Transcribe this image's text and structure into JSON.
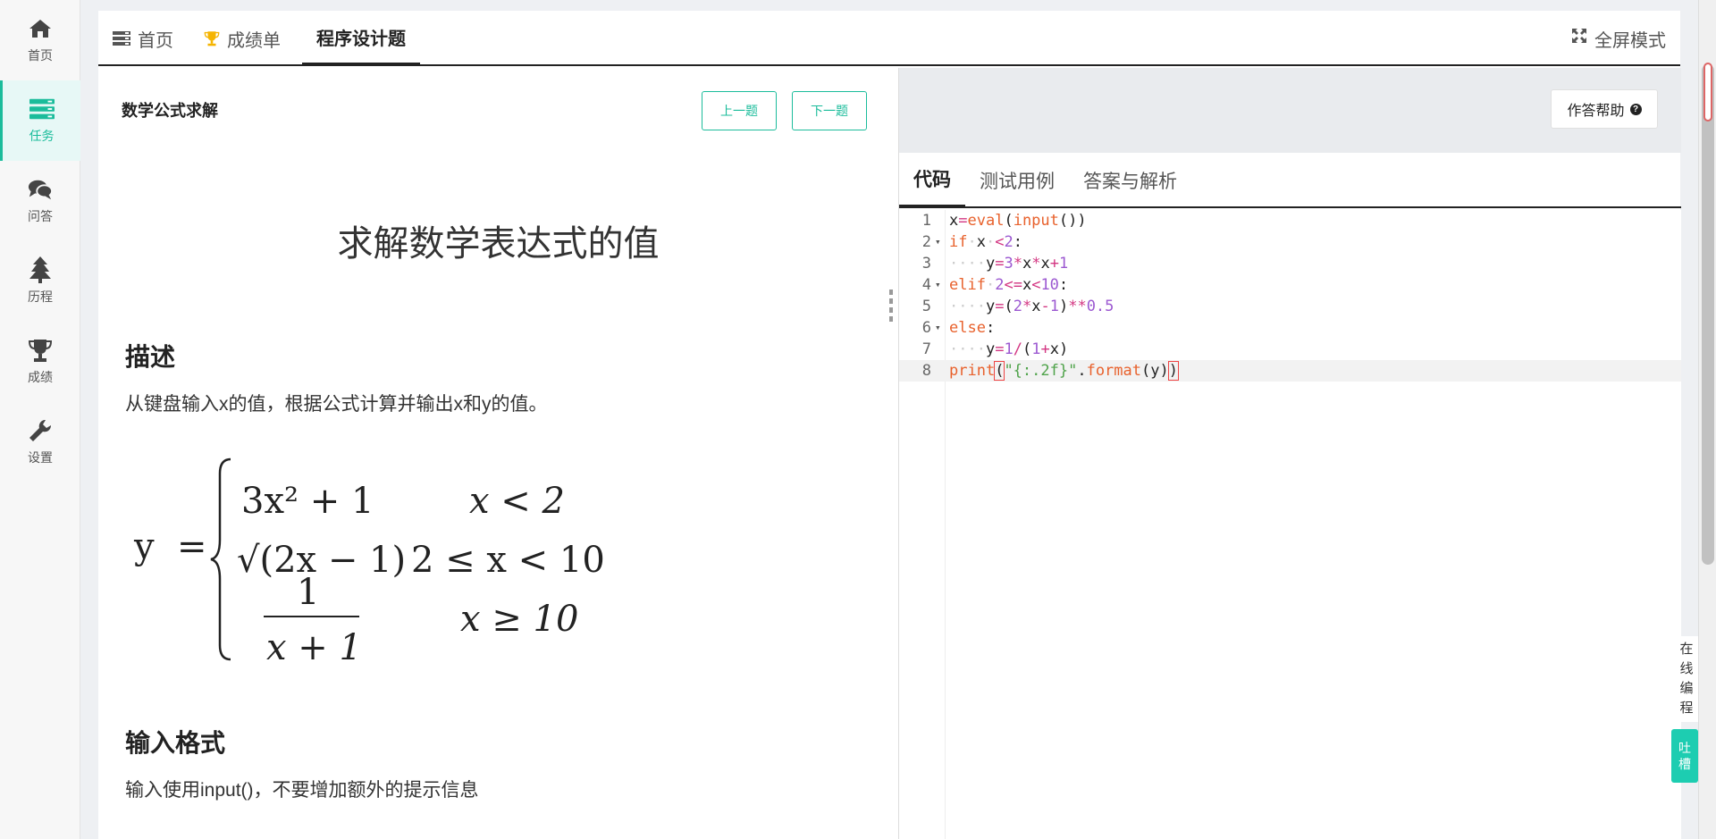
{
  "sidebar": {
    "items": [
      {
        "label": "首页",
        "icon": "home-icon"
      },
      {
        "label": "任务",
        "icon": "tasks-icon"
      },
      {
        "label": "问答",
        "icon": "chat-icon"
      },
      {
        "label": "历程",
        "icon": "tree-icon"
      },
      {
        "label": "成绩",
        "icon": "trophy-icon"
      },
      {
        "label": "设置",
        "icon": "wrench-icon"
      }
    ],
    "active_index": 1
  },
  "topnav": {
    "tabs": [
      {
        "label": "首页",
        "icon": "list-icon"
      },
      {
        "label": "成绩单",
        "icon": "trophy-icon"
      },
      {
        "label": "程序设计题",
        "icon": ""
      }
    ],
    "active_index": 2,
    "fullscreen_label": "全屏模式"
  },
  "question": {
    "title": "数学公式求解",
    "prev_label": "上一题",
    "next_label": "下一题",
    "heading": "求解数学表达式的值",
    "desc_heading": "描述",
    "desc_text": "从键盘输入x的值，根据公式计算并输出x和y的值。",
    "input_heading": "输入格式",
    "input_text": "输入使用input()，不要增加额外的提示信息"
  },
  "formula": {
    "lhs": "y",
    "eq": "=",
    "case1_expr": "3x² + 1",
    "case1_cond": "x < 2",
    "case2_expr": "√(2x − 1)",
    "case2_cond": "2 ≤ x < 10",
    "case3_num": "1",
    "case3_den": "x + 1",
    "case3_cond": "x ≥ 10"
  },
  "editor_panel": {
    "help_label": "作答帮助",
    "tabs": [
      "代码",
      "测试用例",
      "答案与解析"
    ],
    "active_tab": 0
  },
  "code_lines": [
    "x=eval(input())",
    "if x <2:",
    "    y=3*x*x+1",
    "elif 2<=x<10:",
    "    y=(2*x-1)**0.5",
    "else:",
    "    y=1/(1+x)",
    "print(\"{:.2f}\".format(y))"
  ],
  "float": {
    "label_chars": [
      "在",
      "线",
      "编",
      "程"
    ],
    "button_chars": [
      "吐",
      "槽"
    ]
  },
  "colors": {
    "accent": "#1bbc9b",
    "keyword": "#e8612c",
    "number": "#9c59d1",
    "string": "#4fa34a"
  }
}
